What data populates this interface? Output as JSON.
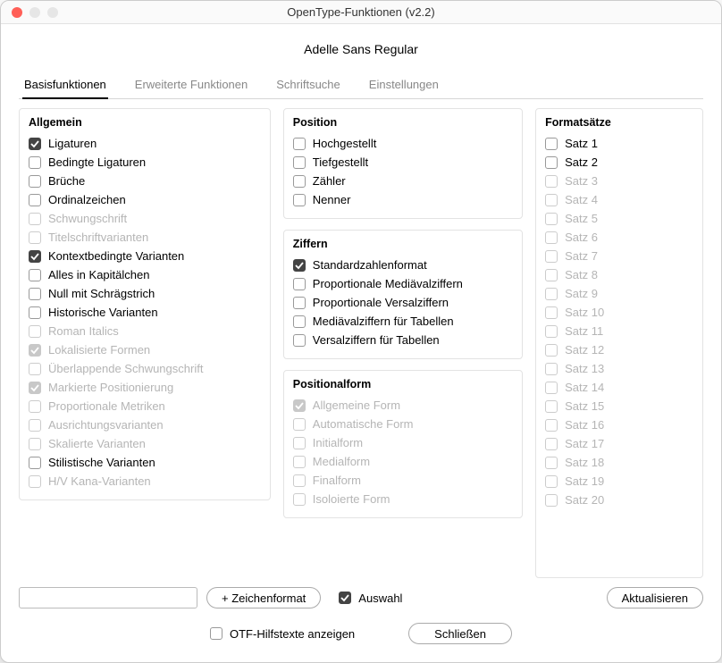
{
  "window": {
    "title": "OpenType-Funktionen (v2.2)"
  },
  "font_name": "Adelle Sans Regular",
  "tabs": [
    {
      "label": "Basisfunktionen",
      "active": true
    },
    {
      "label": "Erweiterte Funktionen",
      "active": false
    },
    {
      "label": "Schriftsuche",
      "active": false
    },
    {
      "label": "Einstellungen",
      "active": false
    }
  ],
  "groups": {
    "allgemein": {
      "title": "Allgemein",
      "items": [
        {
          "label": "Ligaturen",
          "checked": true,
          "disabled": false
        },
        {
          "label": "Bedingte Ligaturen",
          "checked": false,
          "disabled": false
        },
        {
          "label": "Brüche",
          "checked": false,
          "disabled": false
        },
        {
          "label": "Ordinalzeichen",
          "checked": false,
          "disabled": false
        },
        {
          "label": "Schwungschrift",
          "checked": false,
          "disabled": true
        },
        {
          "label": "Titelschriftvarianten",
          "checked": false,
          "disabled": true
        },
        {
          "label": "Kontextbedingte Varianten",
          "checked": true,
          "disabled": false
        },
        {
          "label": "Alles in Kapitälchen",
          "checked": false,
          "disabled": false
        },
        {
          "label": "Null mit Schrägstrich",
          "checked": false,
          "disabled": false
        },
        {
          "label": "Historische Varianten",
          "checked": false,
          "disabled": false
        },
        {
          "label": "Roman Italics",
          "checked": false,
          "disabled": true
        },
        {
          "label": "Lokalisierte Formen",
          "checked": true,
          "disabled": true
        },
        {
          "label": "Überlappende Schwungschrift",
          "checked": false,
          "disabled": true
        },
        {
          "label": "Markierte Positionierung",
          "checked": true,
          "disabled": true
        },
        {
          "label": "Proportionale Metriken",
          "checked": false,
          "disabled": true
        },
        {
          "label": "Ausrichtungsvarianten",
          "checked": false,
          "disabled": true
        },
        {
          "label": "Skalierte Varianten",
          "checked": false,
          "disabled": true
        },
        {
          "label": "Stilistische Varianten",
          "checked": false,
          "disabled": false
        },
        {
          "label": "H/V Kana-Varianten",
          "checked": false,
          "disabled": true
        }
      ]
    },
    "position": {
      "title": "Position",
      "items": [
        {
          "label": "Hochgestellt",
          "checked": false,
          "disabled": false
        },
        {
          "label": "Tiefgestellt",
          "checked": false,
          "disabled": false
        },
        {
          "label": "Zähler",
          "checked": false,
          "disabled": false
        },
        {
          "label": "Nenner",
          "checked": false,
          "disabled": false
        }
      ]
    },
    "ziffern": {
      "title": "Ziffern",
      "items": [
        {
          "label": "Standardzahlenformat",
          "checked": true,
          "disabled": false
        },
        {
          "label": "Proportionale Mediävalziffern",
          "checked": false,
          "disabled": false
        },
        {
          "label": "Proportionale Versalziffern",
          "checked": false,
          "disabled": false
        },
        {
          "label": "Mediävalziffern für Tabellen",
          "checked": false,
          "disabled": false
        },
        {
          "label": "Versalziffern für Tabellen",
          "checked": false,
          "disabled": false
        }
      ]
    },
    "positionalform": {
      "title": "Positionalform",
      "items": [
        {
          "label": "Allgemeine Form",
          "checked": true,
          "disabled": true
        },
        {
          "label": "Automatische Form",
          "checked": false,
          "disabled": true
        },
        {
          "label": "Initialform",
          "checked": false,
          "disabled": true
        },
        {
          "label": "Medialform",
          "checked": false,
          "disabled": true
        },
        {
          "label": "Finalform",
          "checked": false,
          "disabled": true
        },
        {
          "label": "Isoloierte Form",
          "checked": false,
          "disabled": true
        }
      ]
    },
    "formatsaetze": {
      "title": "Formatsätze",
      "items": [
        {
          "label": "Satz 1",
          "checked": false,
          "disabled": false
        },
        {
          "label": "Satz 2",
          "checked": false,
          "disabled": false
        },
        {
          "label": "Satz 3",
          "checked": false,
          "disabled": true
        },
        {
          "label": "Satz 4",
          "checked": false,
          "disabled": true
        },
        {
          "label": "Satz 5",
          "checked": false,
          "disabled": true
        },
        {
          "label": "Satz 6",
          "checked": false,
          "disabled": true
        },
        {
          "label": "Satz 7",
          "checked": false,
          "disabled": true
        },
        {
          "label": "Satz 8",
          "checked": false,
          "disabled": true
        },
        {
          "label": "Satz 9",
          "checked": false,
          "disabled": true
        },
        {
          "label": "Satz 10",
          "checked": false,
          "disabled": true
        },
        {
          "label": "Satz 11",
          "checked": false,
          "disabled": true
        },
        {
          "label": "Satz 12",
          "checked": false,
          "disabled": true
        },
        {
          "label": "Satz 13",
          "checked": false,
          "disabled": true
        },
        {
          "label": "Satz 14",
          "checked": false,
          "disabled": true
        },
        {
          "label": "Satz 15",
          "checked": false,
          "disabled": true
        },
        {
          "label": "Satz 16",
          "checked": false,
          "disabled": true
        },
        {
          "label": "Satz 17",
          "checked": false,
          "disabled": true
        },
        {
          "label": "Satz 18",
          "checked": false,
          "disabled": true
        },
        {
          "label": "Satz 19",
          "checked": false,
          "disabled": true
        },
        {
          "label": "Satz 20",
          "checked": false,
          "disabled": true
        }
      ]
    }
  },
  "bottom": {
    "add_format_label": "+ Zeichenformat",
    "auswahl_label": "Auswahl",
    "auswahl_checked": true,
    "aktualisieren_label": "Aktualisieren"
  },
  "footer": {
    "hilfetexte_label": "OTF-Hilfstexte anzeigen",
    "hilfetexte_checked": false,
    "schliessen_label": "Schließen"
  }
}
